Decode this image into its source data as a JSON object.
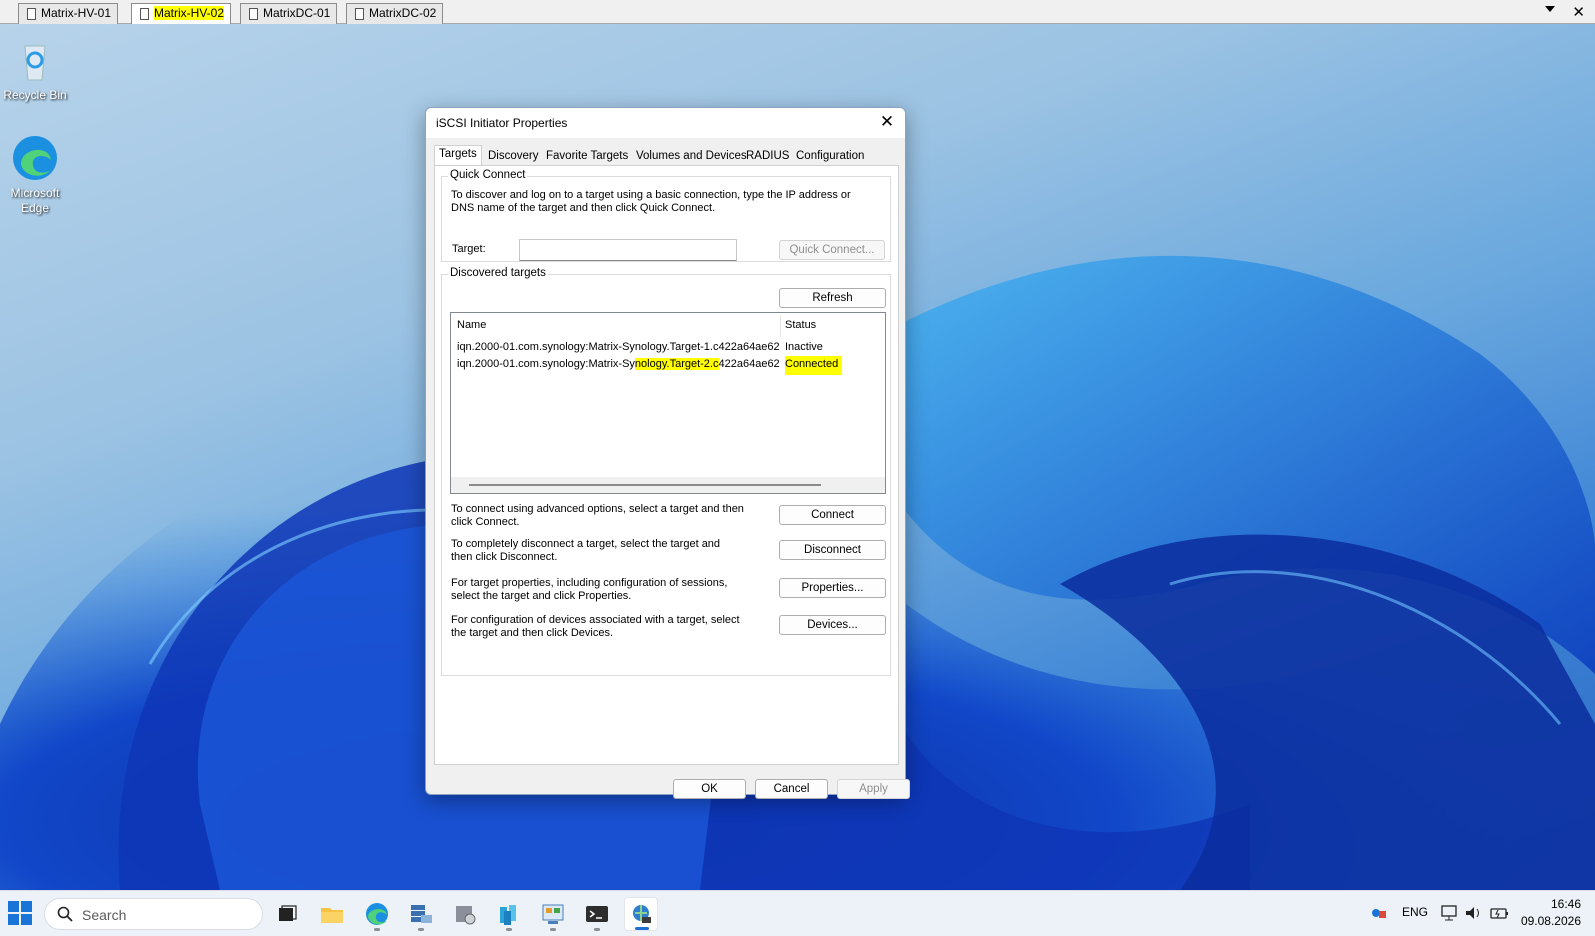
{
  "rdp_tabs": [
    {
      "label": "Matrix-HV-01",
      "active": false,
      "highlighted": false
    },
    {
      "label": "Matrix-HV-02",
      "active": true,
      "highlighted": true
    },
    {
      "label": "MatrixDC-01",
      "active": false,
      "highlighted": false
    },
    {
      "label": "MatrixDC-02",
      "active": false,
      "highlighted": false
    }
  ],
  "desktop_icons": [
    {
      "label": "Recycle Bin",
      "icon": "recycle-bin-icon"
    },
    {
      "label": "Microsoft Edge",
      "icon": "edge-icon"
    }
  ],
  "dialog": {
    "title": "iSCSI Initiator Properties",
    "tabs": [
      "Targets",
      "Discovery",
      "Favorite Targets",
      "Volumes and Devices",
      "RADIUS",
      "Configuration"
    ],
    "active_tab": "Targets",
    "quick_connect": {
      "group_label": "Quick Connect",
      "description": "To discover and log on to a target using a basic connection, type the IP address or DNS name of the target and then click Quick Connect.",
      "target_label": "Target:",
      "target_value": "",
      "button": "Quick Connect..."
    },
    "discovered": {
      "group_label": "Discovered targets",
      "refresh_button": "Refresh",
      "columns": [
        "Name",
        "Status"
      ],
      "rows": [
        {
          "name": "iqn.2000-01.com.synology:Matrix-Synology.Target-1.c422a64ae62",
          "status": "Inactive",
          "highlighted": false
        },
        {
          "name_pre": "iqn.2000-01.com.synology:Matrix-Sy",
          "name_hl": "nology.Target-2.c",
          "name_post": "422a64ae62",
          "status": "Connected",
          "highlighted": true
        }
      ]
    },
    "actions": [
      {
        "text": "To connect using advanced options, select a target and then click Connect.",
        "button": "Connect"
      },
      {
        "text": "To completely disconnect a target, select the target and then click Disconnect.",
        "button": "Disconnect"
      },
      {
        "text": "For target properties, including configuration of sessions, select the target and click Properties.",
        "button": "Properties..."
      },
      {
        "text": "For configuration of devices associated with a target, select the target and then click Devices.",
        "button": "Devices..."
      }
    ],
    "footer": {
      "ok": "OK",
      "cancel": "Cancel",
      "apply": "Apply"
    }
  },
  "taskbar": {
    "search_placeholder": "Search",
    "apps": [
      "task-view-icon",
      "file-explorer-icon",
      "edge-icon",
      "server-manager-icon",
      "hyper-v-manager-icon",
      "failover-cluster-icon",
      "control-panel-icon",
      "terminal-icon",
      "iscsi-initiator-icon"
    ],
    "language": "ENG",
    "time": "16:46",
    "date": "09.08.2026"
  },
  "colors": {
    "highlight": "#ffff00",
    "accent": "#1d6fd6"
  }
}
